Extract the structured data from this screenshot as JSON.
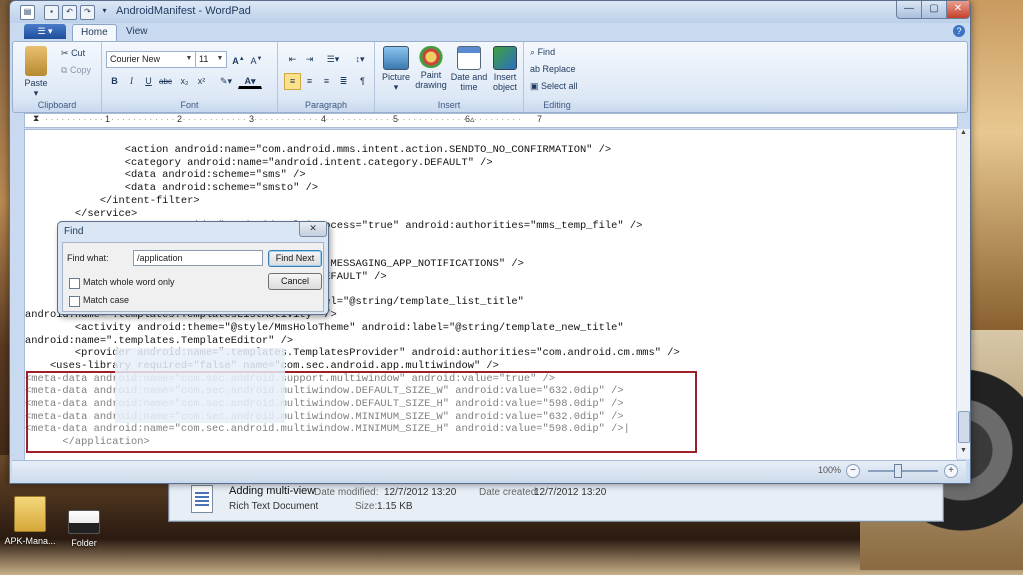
{
  "window": {
    "title": "AndroidManifest - WordPad",
    "controls": {
      "minimize": "—",
      "maximize": "▢",
      "close": "✕"
    },
    "quick_access": [
      "save-icon",
      "undo-icon",
      "redo-icon",
      "customize-icon"
    ]
  },
  "ribbon": {
    "app_menu_label": "▾",
    "tabs": [
      {
        "label": "Home",
        "active": true
      },
      {
        "label": "View",
        "active": false
      }
    ],
    "help": "?",
    "clipboard": {
      "paste": "Paste",
      "cut": "Cut",
      "copy": "Copy",
      "group": "Clipboard"
    },
    "font": {
      "family": "Courier New",
      "size": "11",
      "bold": "B",
      "italic": "I",
      "underline": "U",
      "strike": "abc",
      "sub": "x₂",
      "sup": "x²",
      "group": "Font"
    },
    "paragraph": {
      "group": "Paragraph"
    },
    "insert": {
      "picture": "Picture",
      "paint_line1": "Paint",
      "paint_line2": "drawing",
      "date_line1": "Date and",
      "date_line2": "time",
      "object_line1": "Insert",
      "object_line2": "object",
      "group": "Insert"
    },
    "editing": {
      "find": "Find",
      "replace": "Replace",
      "select_all": "Select all",
      "group": "Editing"
    }
  },
  "ruler": {
    "marks": [
      "1",
      "2",
      "3",
      "4",
      "5",
      "6",
      "7"
    ]
  },
  "document": {
    "lines": [
      {
        "text": "                <action android:name=\"com.android.mms.intent.action.SENDTO_NO_CONFIRMATION\" />",
        "gray": false
      },
      {
        "text": "                <category android:name=\"android.intent.category.DEFAULT\" />",
        "gray": false
      },
      {
        "text": "                <data android:scheme=\"sms\" />",
        "gray": false
      },
      {
        "text": "                <data android:scheme=\"smsto\" />",
        "gray": false
      },
      {
        "text": "            </intent-filter>",
        "gray": false
      },
      {
        "text": "        </service>",
        "gray": false
      },
      {
        "text": "                           ider\" android:multiprocess=\"true\" android:authorities=\"mms_temp_file\" />",
        "gray": false
      },
      {
        "text": "                           erenceActivity\">",
        "gray": false
      },
      {
        "text": "",
        "gray": false
      },
      {
        "text": "                           oid.mms.intent.action.MESSAGING_APP_NOTIFICATIONS\" />",
        "gray": false
      },
      {
        "text": "                           oid.intent.category.DEFAULT\" />",
        "gray": false
      },
      {
        "text": "",
        "gray": false
      },
      {
        "text": "                           oloTheme\" android:label=\"@string/template_list_title\"",
        "gray": false
      },
      {
        "text": "android:name=\".templates.TemplatesListActivity\" />",
        "gray": false
      },
      {
        "text": "        <activity android:theme=\"@style/MmsHoloTheme\" android:label=\"@string/template_new_title\"",
        "gray": false
      },
      {
        "text": "android:name=\".templates.TemplateEditor\" />",
        "gray": false
      },
      {
        "text": "        <provider android:name=\".templates.TemplatesProvider\" android:authorities=\"com.android.cm.mms\" />",
        "gray": false
      },
      {
        "text": "    <uses-library required=\"false\" name=\"com.sec.android.app.multiwindow\" />",
        "gray": false
      },
      {
        "text": "<meta-data android:name=\"com.sec.android.support.multiwindow\" android:value=\"true\" />",
        "gray": true
      },
      {
        "text": "<meta-data android:name=\"com.sec.android.multiwindow.DEFAULT_SIZE_W\" android:value=\"632.0dip\" />",
        "gray": true
      },
      {
        "text": "<meta-data android:name=\"com.sec.android.multiwindow.DEFAULT_SIZE_H\" android:value=\"598.0dip\" />",
        "gray": true
      },
      {
        "text": "<meta-data android:name=\"com.sec.android.multiwindow.MINIMUM_SIZE_W\" android:value=\"632.0dip\" />",
        "gray": true
      },
      {
        "text": "<meta-data android:name=\"com.sec.android.multiwindow.MINIMUM_SIZE_H\" android:value=\"598.0dip\" />|",
        "gray": true
      },
      {
        "text": "      </application>",
        "gray": true
      }
    ]
  },
  "status": {
    "zoom": "100%",
    "zoom_out": "−",
    "zoom_in": "+"
  },
  "find_dialog": {
    "title": "Find",
    "close": "✕",
    "find_what_label": "Find what:",
    "find_what_value": "/application",
    "match_whole_word": "Match whole word only",
    "match_case": "Match case",
    "find_next": "Find Next",
    "cancel": "Cancel"
  },
  "explorer": {
    "name": "Adding multi-view",
    "modified_label": "Date modified:",
    "modified": "12/7/2012 13:20",
    "created_label": "Date created:",
    "created": "12/7/2012 13:20",
    "type": "Rich Text Document",
    "size_label": "Size:",
    "size": "1.15 KB"
  },
  "desktop": {
    "icons": [
      {
        "label": "APK-Mana..."
      },
      {
        "label": "Folder"
      }
    ]
  }
}
